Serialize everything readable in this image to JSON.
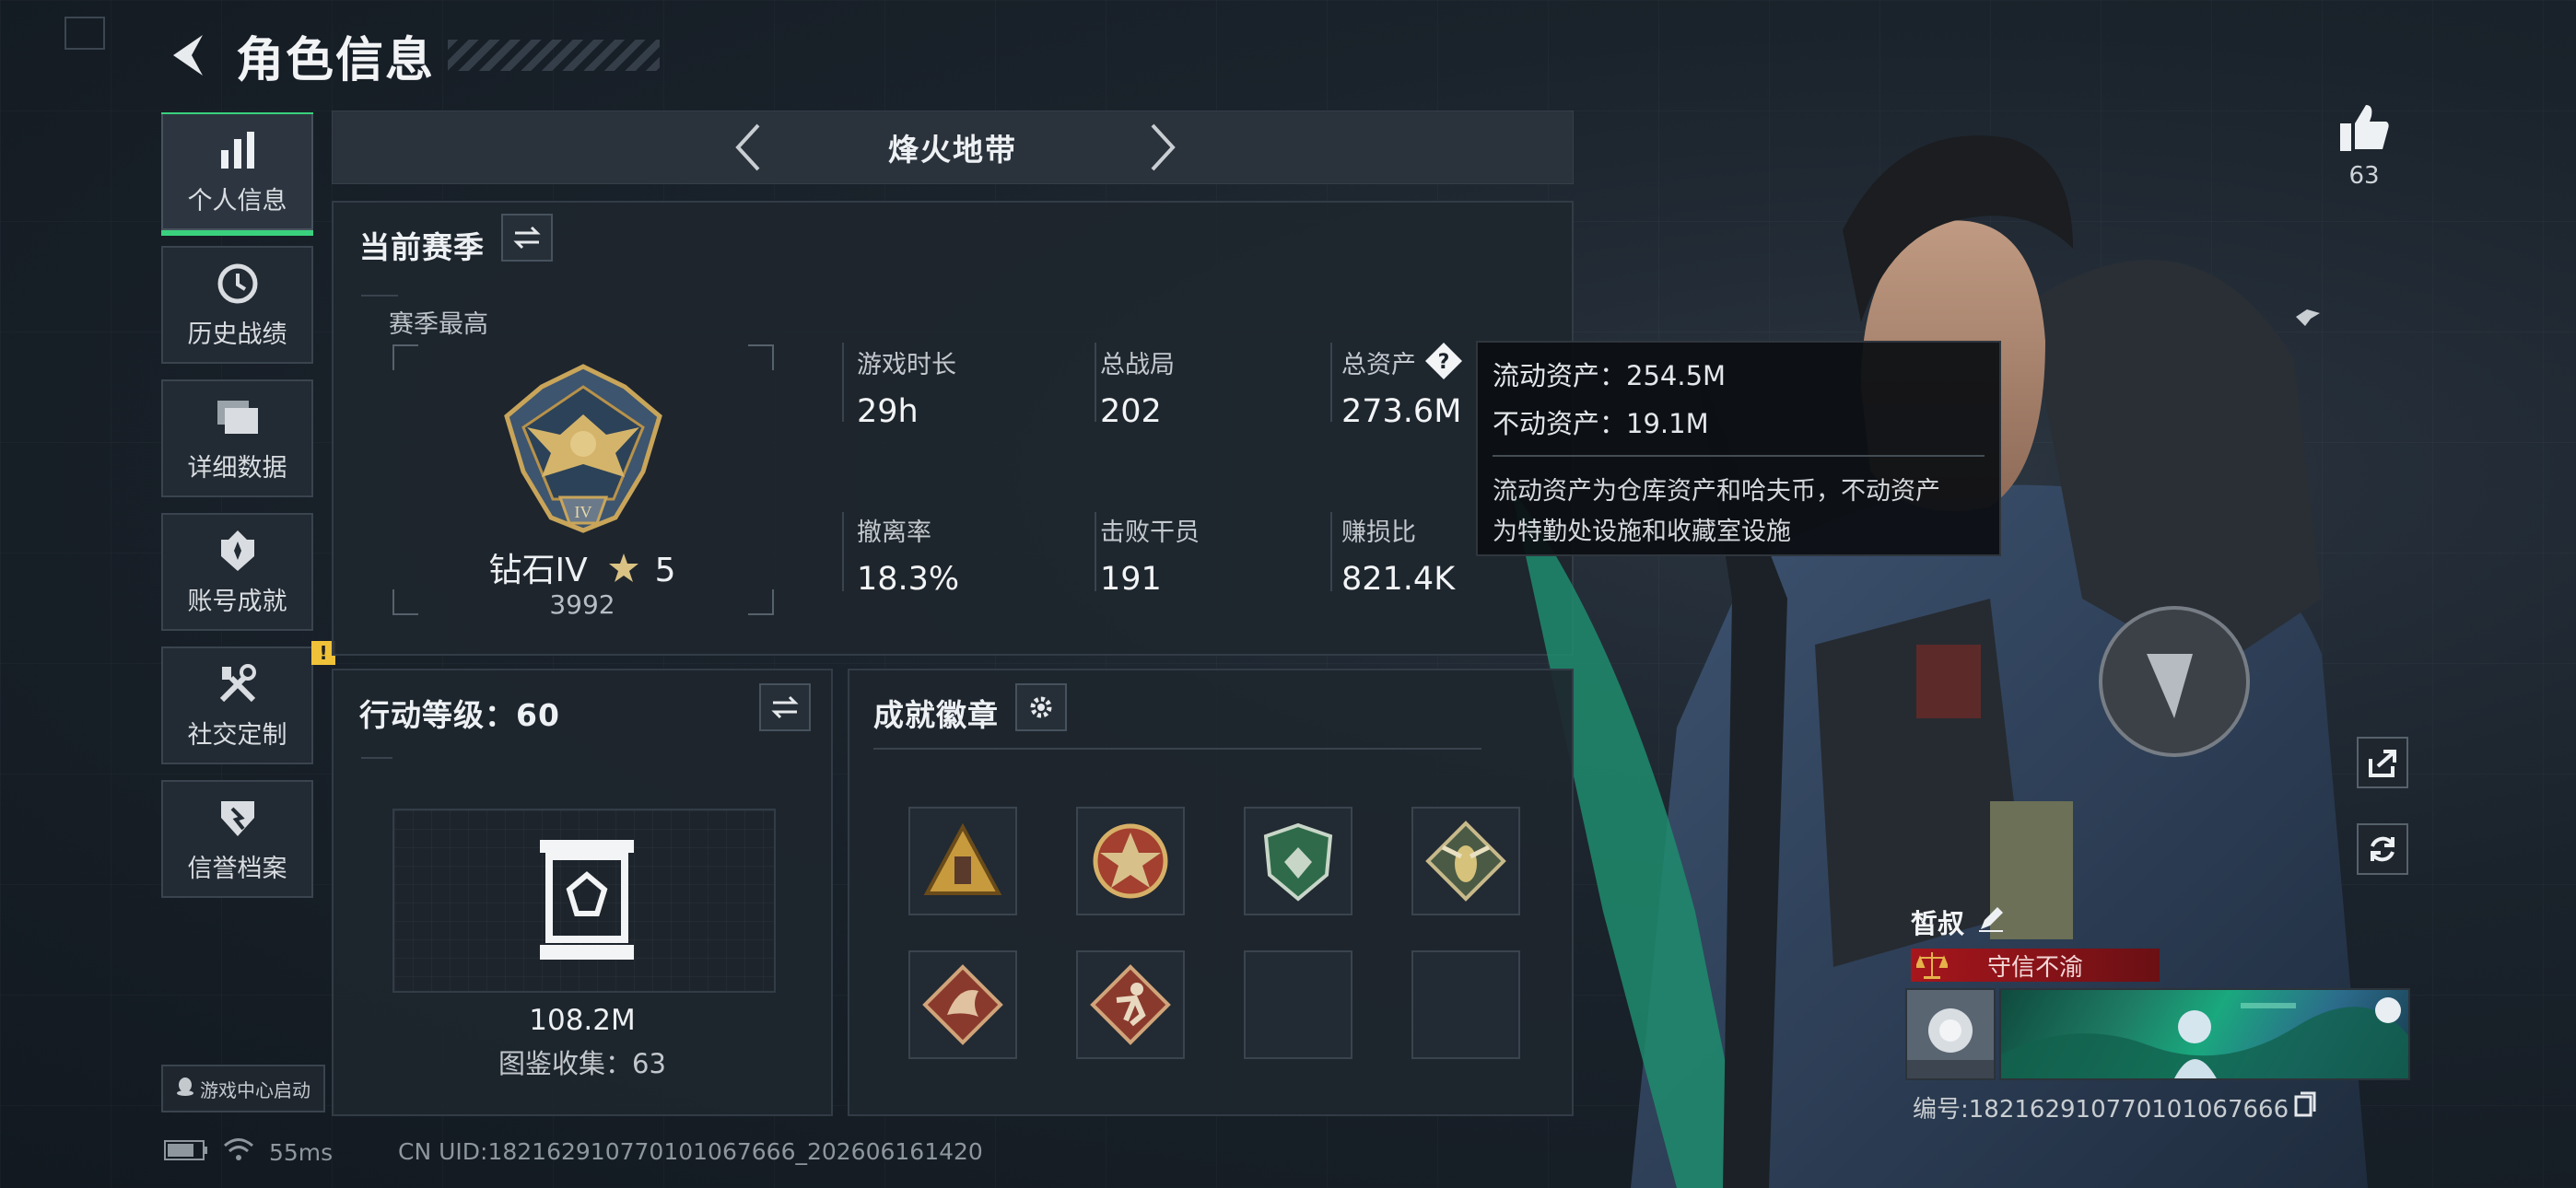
{
  "header": {
    "title": "角色信息"
  },
  "nav": {
    "items": [
      {
        "label": "个人信息",
        "icon": "bar-chart-icon",
        "active": true
      },
      {
        "label": "历史战绩",
        "icon": "history-icon"
      },
      {
        "label": "详细数据",
        "icon": "folders-icon"
      },
      {
        "label": "账号成就",
        "icon": "achievement-icon"
      },
      {
        "label": "社交定制",
        "icon": "tools-icon",
        "badge": "!"
      },
      {
        "label": "信誉档案",
        "icon": "credit-shield-icon"
      }
    ],
    "launch_label": "游戏中心启动"
  },
  "mode": {
    "name": "烽火地带"
  },
  "season": {
    "title": "当前赛季",
    "sub_title": "赛季最高",
    "rank_name": "钻石IV",
    "rank_stars": "5",
    "rank_score": "3992",
    "stats": [
      {
        "label": "游戏时长",
        "value": "29h"
      },
      {
        "label": "总战局",
        "value": "202"
      },
      {
        "label": "总资产",
        "value": "273.6M"
      },
      {
        "label": "撤离率",
        "value": "18.3%"
      },
      {
        "label": "击败干员",
        "value": "191"
      },
      {
        "label": "赚损比",
        "value": "821.4K"
      }
    ]
  },
  "tooltip": {
    "liquid": "流动资产：254.5M",
    "fixed": "不动资产：19.1M",
    "desc_line1": "流动资产为仓库资产和哈夫币，不动资产",
    "desc_line2": "为特勤处设施和收藏室设施"
  },
  "level": {
    "title": "行动等级：60",
    "collection_value": "108.2M",
    "collection_count": "图鉴收集：63"
  },
  "badges": {
    "title": "成就徽章",
    "items": [
      "badge-triangle-icon",
      "badge-star-icon",
      "badge-shield-icon",
      "badge-wasp-icon",
      "badge-dragon-icon",
      "badge-runner-icon",
      "empty",
      "empty"
    ]
  },
  "profile": {
    "likes": "63",
    "name": "皙叔",
    "motto": "守信不渝",
    "id_text": "编号:18216291077010106​7666"
  },
  "status": {
    "ping": "55ms",
    "uid": "CN UID:18216291077010106​7666_202606161420"
  },
  "colors": {
    "accent": "#3ad17e",
    "warn": "#f0c23a",
    "motto_red": "#a6161c"
  }
}
